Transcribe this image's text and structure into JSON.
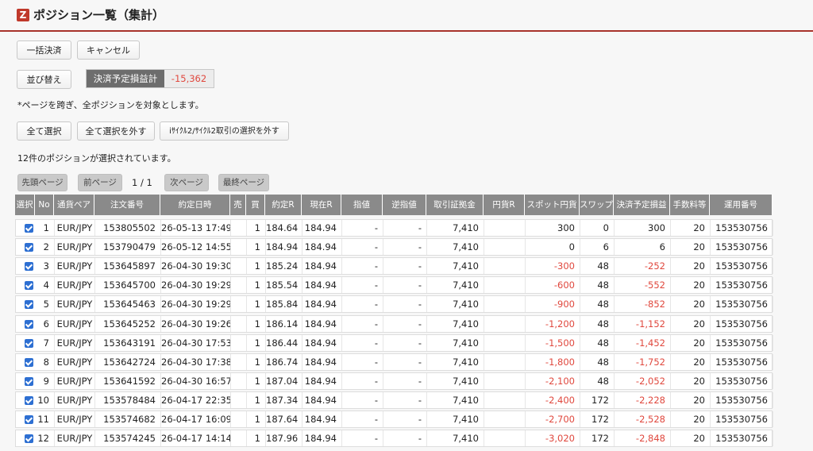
{
  "logo_letter": "Z",
  "title": "ポジション一覧（集計）",
  "buttons": {
    "bulk_settle": "一括決済",
    "cancel": "キャンセル",
    "sort": "並び替え",
    "select_all": "全て選択",
    "deselect_all": "全て選択を外す",
    "deselect_icycle": "iｻｲｸﾙ2/ｻｲｸﾙ2取引の選択を外す",
    "first_page": "先頭ページ",
    "prev_page": "前ページ",
    "next_page": "次ページ",
    "last_page": "最終ページ"
  },
  "pl_summary": {
    "label": "決済予定損益計",
    "value": "-15,362"
  },
  "note": "*ページを跨ぎ、全ポジションを対象とします。",
  "selected_count_text": "12件のポジションが選択されています。",
  "pager": "1 / 1",
  "columns": [
    "選択",
    "No",
    "通貨ペア",
    "注文番号",
    "約定日時",
    "売",
    "買",
    "約定R",
    "現在R",
    "指値",
    "逆指値",
    "取引証拠金",
    "円貨R",
    "スポット円貨",
    "スワップ",
    "決済予定損益",
    "手数料等",
    "運用番号"
  ],
  "rows": [
    {
      "selected": true,
      "no": "1",
      "pair": "EUR/JPY",
      "order": "153805502",
      "datetime": "26-05-13 17:49",
      "sell": "",
      "buy": "1",
      "exec_rate": "184.64",
      "current_rate": "184.94",
      "limit": "-",
      "stop": "-",
      "margin": "7,410",
      "yen_rate": "",
      "spot": "300",
      "swap": "0",
      "pl": "300",
      "fee": "20",
      "op_no": "153530756"
    },
    {
      "selected": true,
      "no": "2",
      "pair": "EUR/JPY",
      "order": "153790479",
      "datetime": "26-05-12 14:55",
      "sell": "",
      "buy": "1",
      "exec_rate": "184.94",
      "current_rate": "184.94",
      "limit": "-",
      "stop": "-",
      "margin": "7,410",
      "yen_rate": "",
      "spot": "0",
      "swap": "6",
      "pl": "6",
      "fee": "20",
      "op_no": "153530756"
    },
    {
      "selected": true,
      "no": "3",
      "pair": "EUR/JPY",
      "order": "153645897",
      "datetime": "26-04-30 19:30",
      "sell": "",
      "buy": "1",
      "exec_rate": "185.24",
      "current_rate": "184.94",
      "limit": "-",
      "stop": "-",
      "margin": "7,410",
      "yen_rate": "",
      "spot": "-300",
      "swap": "48",
      "pl": "-252",
      "fee": "20",
      "op_no": "153530756"
    },
    {
      "selected": true,
      "no": "4",
      "pair": "EUR/JPY",
      "order": "153645700",
      "datetime": "26-04-30 19:29",
      "sell": "",
      "buy": "1",
      "exec_rate": "185.54",
      "current_rate": "184.94",
      "limit": "-",
      "stop": "-",
      "margin": "7,410",
      "yen_rate": "",
      "spot": "-600",
      "swap": "48",
      "pl": "-552",
      "fee": "20",
      "op_no": "153530756"
    },
    {
      "selected": true,
      "no": "5",
      "pair": "EUR/JPY",
      "order": "153645463",
      "datetime": "26-04-30 19:29",
      "sell": "",
      "buy": "1",
      "exec_rate": "185.84",
      "current_rate": "184.94",
      "limit": "-",
      "stop": "-",
      "margin": "7,410",
      "yen_rate": "",
      "spot": "-900",
      "swap": "48",
      "pl": "-852",
      "fee": "20",
      "op_no": "153530756"
    },
    {
      "selected": true,
      "no": "6",
      "pair": "EUR/JPY",
      "order": "153645252",
      "datetime": "26-04-30 19:26",
      "sell": "",
      "buy": "1",
      "exec_rate": "186.14",
      "current_rate": "184.94",
      "limit": "-",
      "stop": "-",
      "margin": "7,410",
      "yen_rate": "",
      "spot": "-1,200",
      "swap": "48",
      "pl": "-1,152",
      "fee": "20",
      "op_no": "153530756"
    },
    {
      "selected": true,
      "no": "7",
      "pair": "EUR/JPY",
      "order": "153643191",
      "datetime": "26-04-30 17:53",
      "sell": "",
      "buy": "1",
      "exec_rate": "186.44",
      "current_rate": "184.94",
      "limit": "-",
      "stop": "-",
      "margin": "7,410",
      "yen_rate": "",
      "spot": "-1,500",
      "swap": "48",
      "pl": "-1,452",
      "fee": "20",
      "op_no": "153530756"
    },
    {
      "selected": true,
      "no": "8",
      "pair": "EUR/JPY",
      "order": "153642724",
      "datetime": "26-04-30 17:38",
      "sell": "",
      "buy": "1",
      "exec_rate": "186.74",
      "current_rate": "184.94",
      "limit": "-",
      "stop": "-",
      "margin": "7,410",
      "yen_rate": "",
      "spot": "-1,800",
      "swap": "48",
      "pl": "-1,752",
      "fee": "20",
      "op_no": "153530756"
    },
    {
      "selected": true,
      "no": "9",
      "pair": "EUR/JPY",
      "order": "153641592",
      "datetime": "26-04-30 16:57",
      "sell": "",
      "buy": "1",
      "exec_rate": "187.04",
      "current_rate": "184.94",
      "limit": "-",
      "stop": "-",
      "margin": "7,410",
      "yen_rate": "",
      "spot": "-2,100",
      "swap": "48",
      "pl": "-2,052",
      "fee": "20",
      "op_no": "153530756"
    },
    {
      "selected": true,
      "no": "10",
      "pair": "EUR/JPY",
      "order": "153578484",
      "datetime": "26-04-17 22:35",
      "sell": "",
      "buy": "1",
      "exec_rate": "187.34",
      "current_rate": "184.94",
      "limit": "-",
      "stop": "-",
      "margin": "7,410",
      "yen_rate": "",
      "spot": "-2,400",
      "swap": "172",
      "pl": "-2,228",
      "fee": "20",
      "op_no": "153530756"
    },
    {
      "selected": true,
      "no": "11",
      "pair": "EUR/JPY",
      "order": "153574682",
      "datetime": "26-04-17 16:09",
      "sell": "",
      "buy": "1",
      "exec_rate": "187.64",
      "current_rate": "184.94",
      "limit": "-",
      "stop": "-",
      "margin": "7,410",
      "yen_rate": "",
      "spot": "-2,700",
      "swap": "172",
      "pl": "-2,528",
      "fee": "20",
      "op_no": "153530756"
    },
    {
      "selected": true,
      "no": "12",
      "pair": "EUR/JPY",
      "order": "153574245",
      "datetime": "26-04-17 14:14",
      "sell": "",
      "buy": "1",
      "exec_rate": "187.96",
      "current_rate": "184.94",
      "limit": "-",
      "stop": "-",
      "margin": "7,410",
      "yen_rate": "",
      "spot": "-3,020",
      "swap": "172",
      "pl": "-2,848",
      "fee": "20",
      "op_no": "153530756"
    }
  ],
  "colors": {
    "accent": "#a8332b",
    "negative": "#e0483e",
    "checkbox": "#2d6fd2",
    "header_bg": "#8a8a8a"
  }
}
